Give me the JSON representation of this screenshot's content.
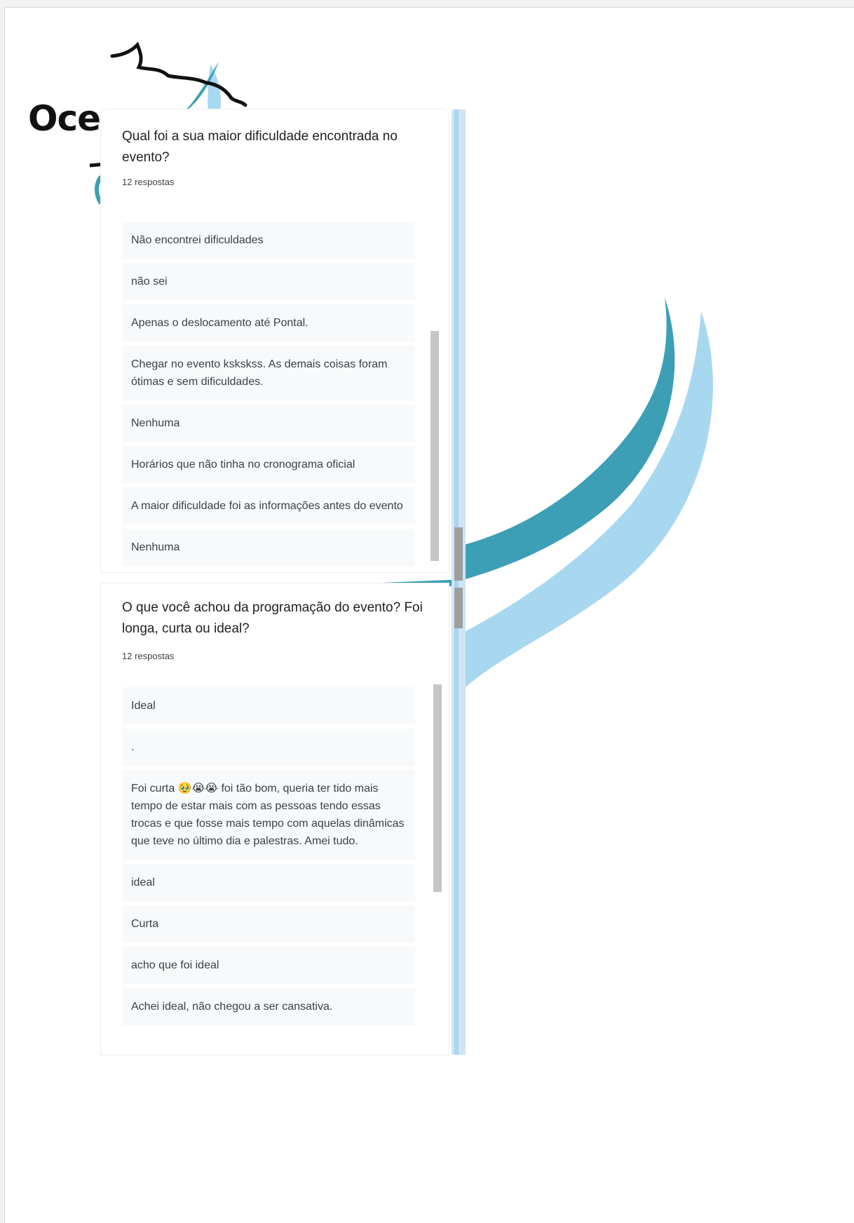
{
  "brand": {
    "logo_text": "Oce",
    "colors": {
      "teal": "#3d9fb6",
      "light_blue": "#a8d8f0",
      "dark_teal": "#1f6f85"
    }
  },
  "questions": [
    {
      "title": "Qual foi a sua maior dificuldade encontrada no evento?",
      "count": "12 respostas",
      "answers": [
        "Não encontrei dificuldades",
        "não sei",
        "Apenas o deslocamento até Pontal.",
        "Chegar no evento kskskss. As demais coisas foram ótimas e sem dificuldades.",
        "Nenhuma",
        "Horários que não tinha no cronograma oficial",
        "A maior dificuldade foi as informações antes do evento",
        "Nenhuma"
      ]
    },
    {
      "title": "O que você achou da programação do evento? Foi longa, curta ou ideal?",
      "count": "12 respostas",
      "answers": [
        "Ideal",
        ".",
        "Foi curta 🥹😭😭 foi tão bom, queria ter tido mais tempo de estar mais com as pessoas tendo essas trocas e que fosse mais tempo com aquelas dinâmicas que teve no último dia e palestras. Amei tudo.",
        "ideal",
        "Curta",
        "acho que foi ideal",
        "Achei ideal, não chegou a ser cansativa."
      ]
    }
  ]
}
